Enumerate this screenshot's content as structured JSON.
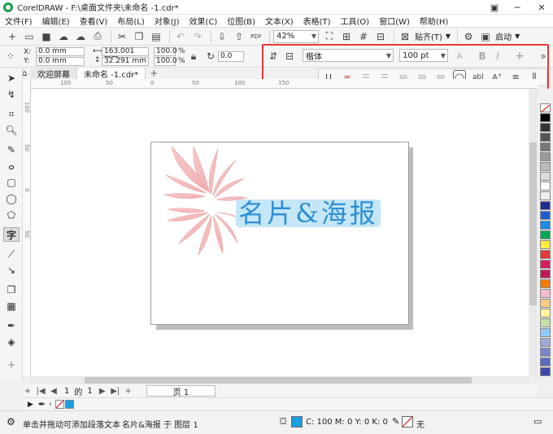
{
  "window": {
    "title": "CorelDRAW - F:\\桌面文件夹\\未命名 -1.cdr*",
    "minimize": "─",
    "maximize": "☐",
    "close": "✕"
  },
  "menu": [
    "文件(F)",
    "编辑(E)",
    "查看(V)",
    "布局(L)",
    "对象(J)",
    "效果(C)",
    "位图(B)",
    "文本(X)",
    "表格(T)",
    "工具(O)",
    "窗口(W)",
    "帮助(H)"
  ],
  "toolbar": {
    "zoom": "42%",
    "snap_label": "贴齐(T)",
    "launch_label": "启动",
    "pdf_label": "PDF"
  },
  "propbar": {
    "x_label": "X:",
    "y_label": "Y:",
    "x": "0.0 mm",
    "y": "0.0 mm",
    "width": "163.001 mm",
    "height": "32.291 mm",
    "scale_w": "100.0",
    "scale_h": "100.0",
    "pct": "%",
    "rotation": "0.0"
  },
  "text_toolbar": {
    "font": "楷体",
    "size": "100 pt",
    "bold": "B",
    "italic": "I",
    "underline": "U",
    "add": "+",
    "more": "»"
  },
  "tabs": {
    "welcome": "欢迎屏幕",
    "document": "未命名 -1.cdr*",
    "add": "+"
  },
  "ruler": {
    "h_marks": [
      "100",
      "50",
      "0",
      "50",
      "100",
      "150"
    ],
    "v_marks": [
      "100",
      "50",
      "0",
      "50"
    ]
  },
  "artwork": {
    "text": "名片&海报",
    "text_color": "#2d8fd6",
    "highlight_color": "#c4e6f7",
    "petal_color": "#f3b6b6"
  },
  "palette": [
    "#ffffff",
    "#000000",
    "#333333",
    "#555555",
    "#777777",
    "#999999",
    "#bbbbbb",
    "#dddddd",
    "#1d2f8f",
    "#1e88e5",
    "#00a94f",
    "#8bc34a",
    "#ffeb3b",
    "#f57c00",
    "#e53935",
    "#d81b60",
    "#f8bbd0",
    "#ffcc80",
    "#fff59d",
    "#c5e1a5",
    "#80cbc4",
    "#90caf9",
    "#b39ddb",
    "#9fa8da",
    "#7986cb",
    "#5c6bc0",
    "#3949ab",
    "#283593"
  ],
  "page_nav": {
    "current": "1",
    "of": "的",
    "total": "1",
    "page_tab": "页 1"
  },
  "status": {
    "hint": "单击并拖动可添加段落文本",
    "object": "名片&海报 于 图层 1",
    "fill": "C: 100 M: 0 Y: 0 K: 0",
    "outline": "无",
    "fill_color": "#1a9fe0"
  }
}
